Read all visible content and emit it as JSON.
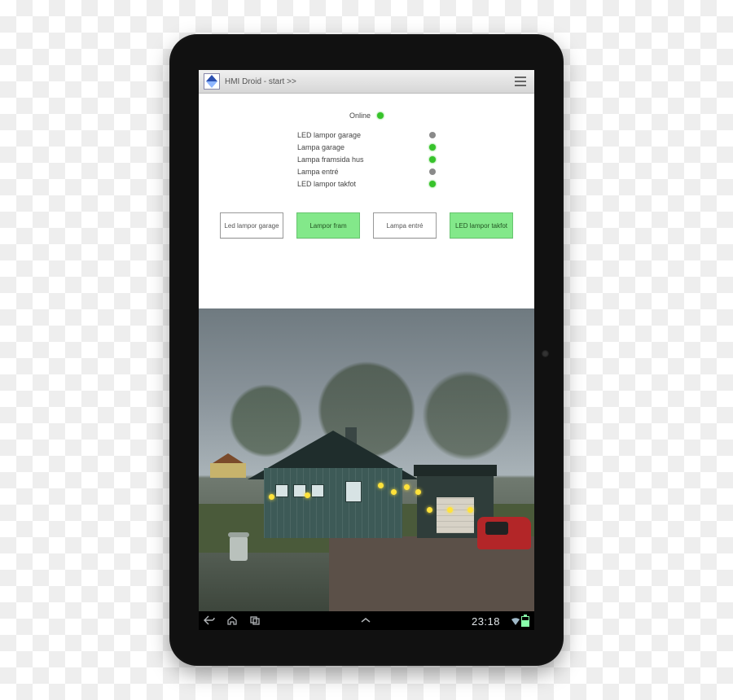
{
  "app": {
    "title": "HMI Droid - start >>"
  },
  "status": {
    "online_label": "Online",
    "items": [
      {
        "label": "LED lampor garage",
        "on": false
      },
      {
        "label": "Lampa garage",
        "on": true
      },
      {
        "label": "Lampa framsida hus",
        "on": true
      },
      {
        "label": "Lampa entré",
        "on": false
      },
      {
        "label": "LED lampor takfot",
        "on": true
      }
    ]
  },
  "buttons": [
    {
      "label": "Led lampor garage",
      "style": "white"
    },
    {
      "label": "Lampor fram",
      "style": "green"
    },
    {
      "label": "Lampa entré",
      "style": "white"
    },
    {
      "label": "LED lampor takfot",
      "style": "green"
    }
  ],
  "navbar": {
    "clock": "23:18"
  }
}
